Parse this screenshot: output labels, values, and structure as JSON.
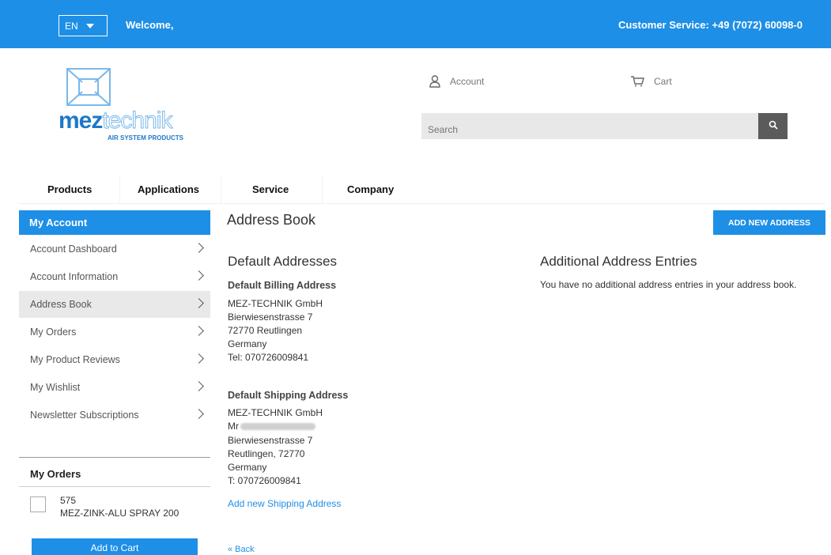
{
  "topbar": {
    "language": "EN",
    "welcome": "Welcome,",
    "customer_service": "Customer Service: +49 (7072) 60098-0"
  },
  "logo": {
    "word_solid": "mez",
    "word_outline": "technik",
    "tagline": "AIR SYSTEM PRODUCTS"
  },
  "header": {
    "account_label": "Account",
    "cart_label": "Cart",
    "search_placeholder": "Search"
  },
  "nav": {
    "items": [
      "Products",
      "Applications",
      "Service",
      "Company"
    ]
  },
  "sidebar": {
    "title": "My Account",
    "items": [
      {
        "label": "Account Dashboard"
      },
      {
        "label": "Account Information"
      },
      {
        "label": "Address Book"
      },
      {
        "label": "My Orders"
      },
      {
        "label": "My Product Reviews"
      },
      {
        "label": "My Wishlist"
      },
      {
        "label": "Newsletter Subscriptions"
      }
    ],
    "active_index": 2,
    "orders": {
      "title": "My Orders",
      "order_number": "575",
      "product_name": "MEZ-ZINK-ALU SPRAY 200",
      "add_to_cart": "Add to Cart"
    }
  },
  "main": {
    "title": "Address Book",
    "add_new_address": "ADD NEW ADDRESS",
    "default_heading": "Default Addresses",
    "billing": {
      "heading": "Default Billing Address",
      "lines": [
        "MEZ-TECHNIK GmbH",
        "Bierwiesenstrasse 7",
        "72770 Reutlingen",
        "Germany",
        "Tel: 070726009841"
      ]
    },
    "shipping": {
      "heading": "Default Shipping Address",
      "company": "MEZ-TECHNIK GmbH",
      "name_prefix": "Mr",
      "lines": [
        "Bierwiesenstrasse 7",
        "Reutlingen, 72770",
        "Germany",
        "T: 070726009841"
      ],
      "add_link": "Add new Shipping Address"
    },
    "additional_heading": "Additional Address Entries",
    "additional_text": "You have no additional address entries in your address book.",
    "back": "« Back"
  },
  "colors": {
    "accent": "#1e8fe6",
    "search_button": "#5b5b5b"
  }
}
